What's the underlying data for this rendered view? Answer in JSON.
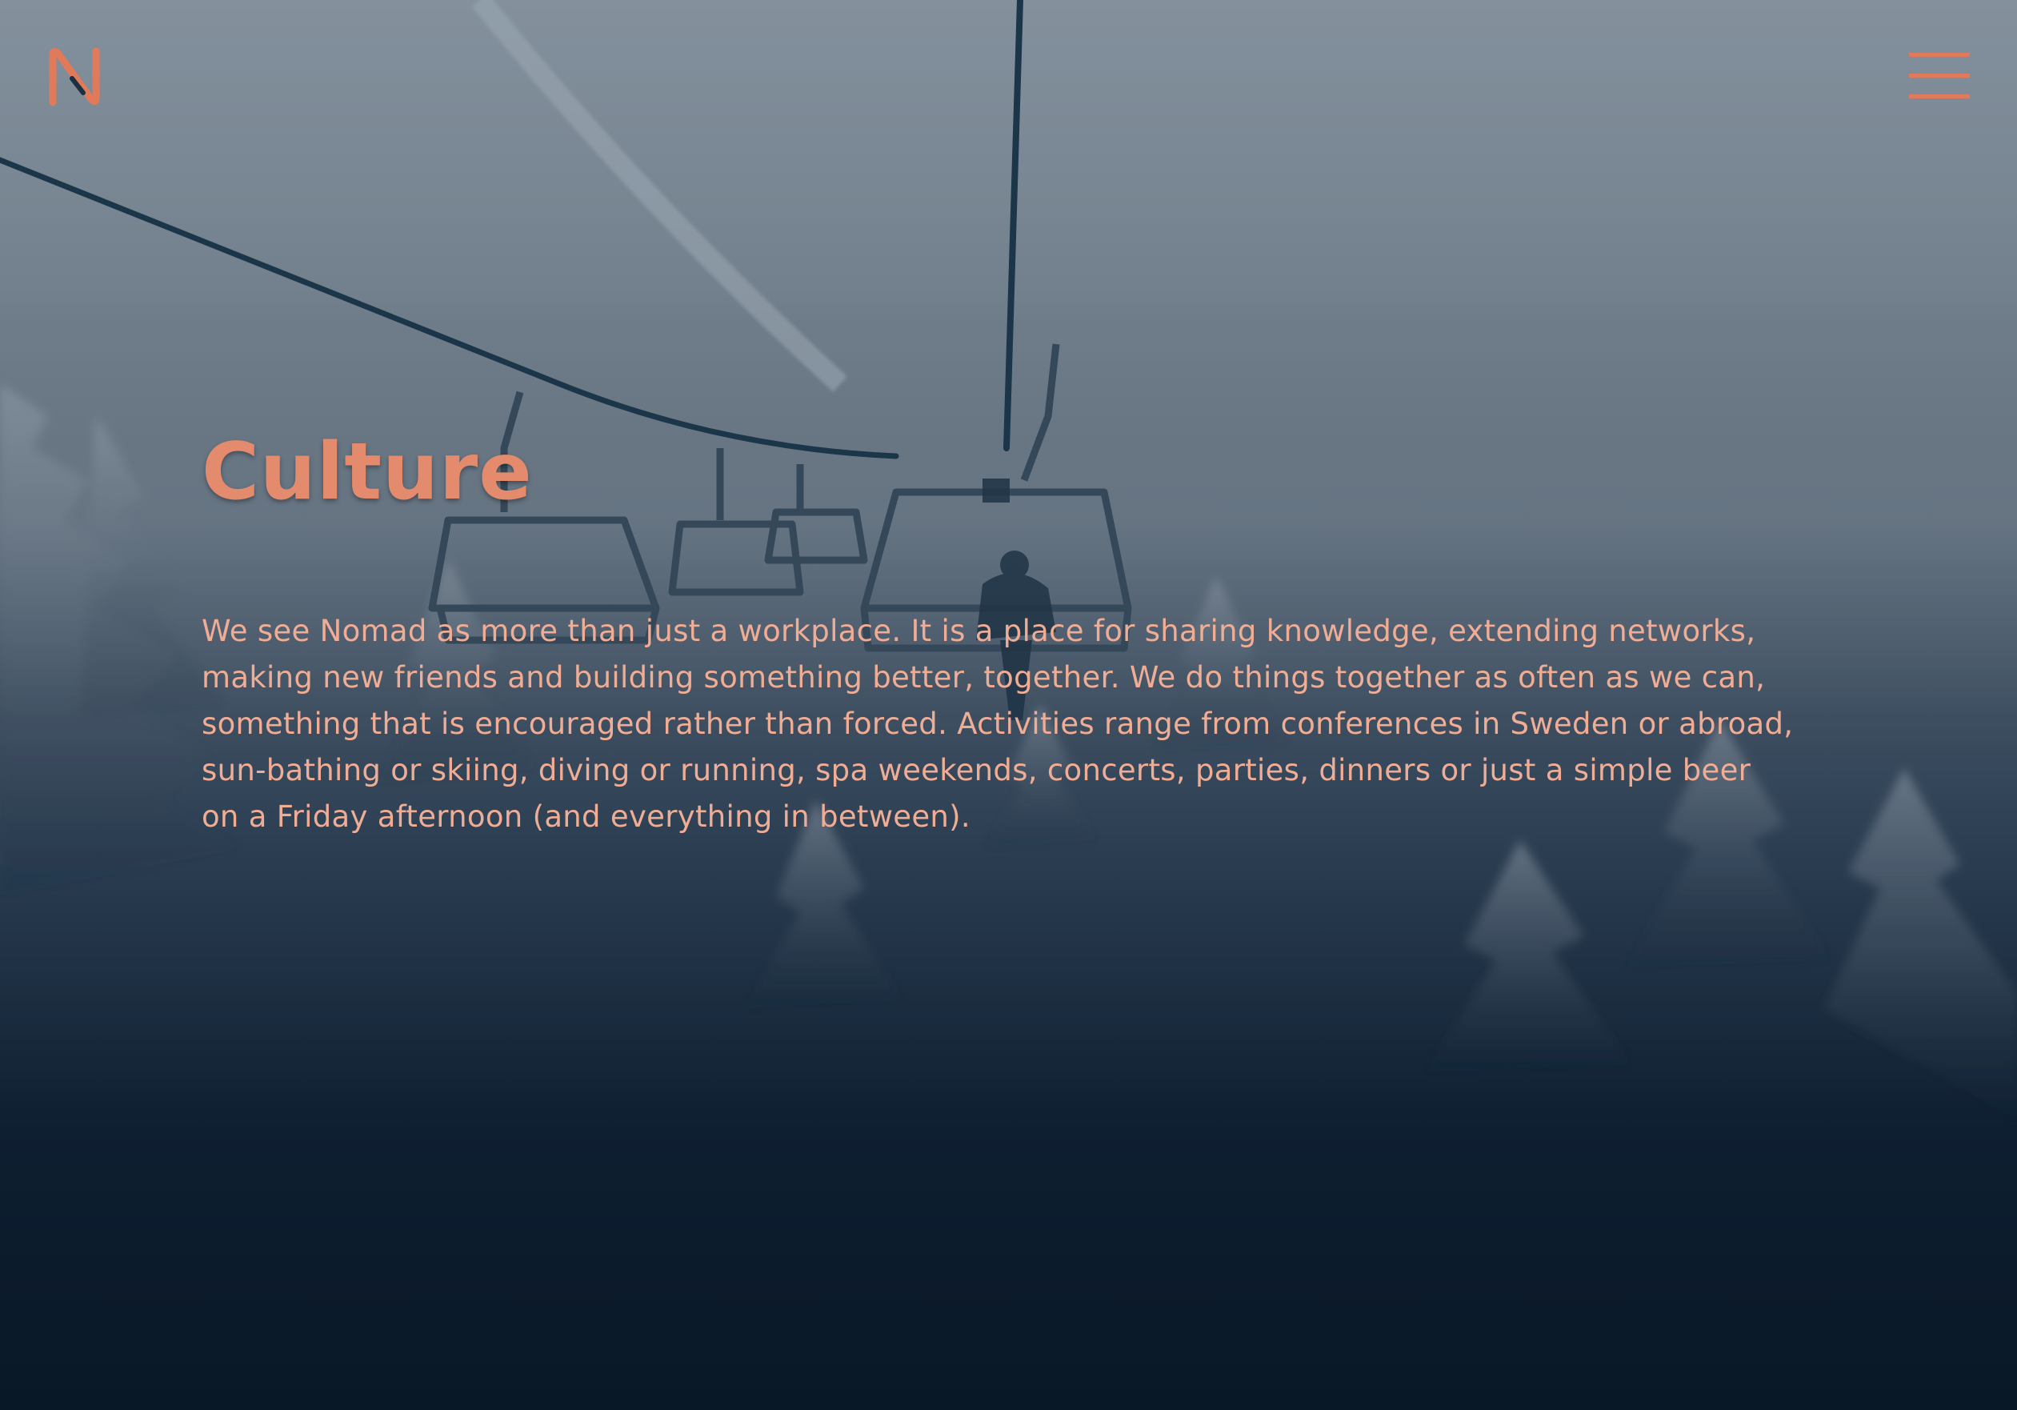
{
  "header": {
    "logo_name": "nomad-logo",
    "menu_icon": "hamburger-menu-icon"
  },
  "colors": {
    "accent": "#e07a5a",
    "title": "#e38b6c",
    "text": "#f0ad95",
    "background_dark": "#0a1826"
  },
  "hero": {
    "image": "snowy-chairlift-forest-photo"
  },
  "main": {
    "title": "Culture",
    "body": "We see Nomad as more than just a workplace. It is a place for sharing knowledge, extending networks, making new friends and building something better, together. We do things together as often as we can, something that is encouraged rather than forced. Activities range from conferences in Sweden or abroad, sun-bathing or skiing, diving or running, spa weekends, concerts, parties, dinners or just a simple beer on a Friday afternoon (and everything in between)."
  }
}
